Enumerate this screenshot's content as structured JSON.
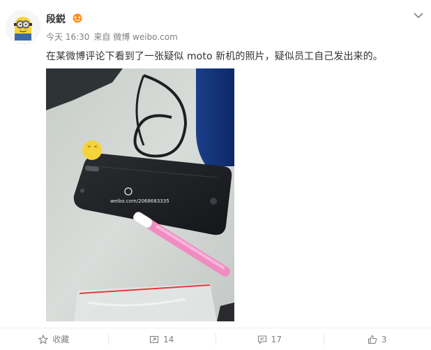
{
  "user": {
    "name": "段鋭",
    "avatar_icon": "minion-avatar",
    "badge_icon": "vip-badge-icon"
  },
  "meta": {
    "time": "今天 16:30",
    "source": "来自 微博 weibo.com"
  },
  "post": {
    "text": "在某微博评论下看到了一张疑似 moto 新机的照片，疑似员工自己发出来的。",
    "watermark": "weibo.com/2068683335"
  },
  "actions": {
    "favorite_label": "收藏",
    "repost_count": "14",
    "comment_count": "17",
    "like_count": "3"
  },
  "colors": {
    "text": "#333333",
    "meta": "#808080",
    "divider": "#f0f0f0"
  }
}
